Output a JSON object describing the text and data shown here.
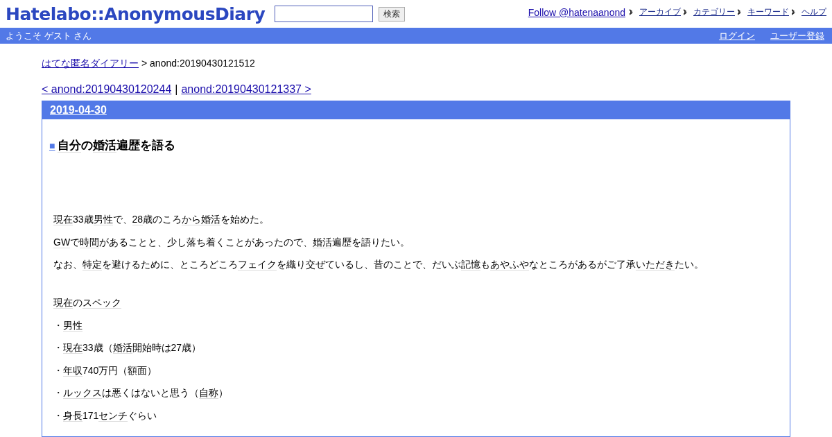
{
  "header": {
    "logo": "Hatelabo::AnonymousDiary",
    "search": {
      "button": "検索"
    },
    "follow": "Follow @hatenaanond",
    "nav": [
      "アーカイブ",
      "カテゴリー",
      "キーワード",
      "ヘルプ"
    ]
  },
  "user_bar": {
    "welcome": "ようこそ ゲスト さん",
    "links": [
      "ログイン",
      "ユーザー登録"
    ]
  },
  "breadcrumb": {
    "link": "はてな匿名ダイアリー",
    "current": "> anond:20190430121512"
  },
  "pager": {
    "prev": "< anond:20190430120244",
    "separator": "|",
    "next": "anond:20190430121337 >"
  },
  "entry": {
    "date": "2019-04-30",
    "marker": "■",
    "title": [
      {
        "text": "自分",
        "kind": "keyword"
      },
      {
        "text": "の",
        "kind": "text"
      },
      {
        "text": "婚活",
        "kind": "keyword"
      },
      {
        "text": "遍歴を語る",
        "kind": "text"
      }
    ],
    "sections": [
      [
        [
          {
            "text": "現在",
            "kind": "keyword"
          },
          {
            "text": "33歳",
            "kind": "text"
          },
          {
            "text": "男性",
            "kind": "keyword"
          },
          {
            "text": "で、",
            "kind": "text"
          },
          {
            "text": "28",
            "kind": "keyword"
          },
          {
            "text": "歳のころ",
            "kind": "text"
          },
          {
            "text": "から",
            "kind": "keyword"
          },
          {
            "text": "婚活",
            "kind": "keyword"
          },
          {
            "text": "を始めた。",
            "kind": "text"
          }
        ],
        [
          {
            "text": "GW",
            "kind": "keyword"
          },
          {
            "text": "で",
            "kind": "text"
          },
          {
            "text": "時間",
            "kind": "keyword"
          },
          {
            "text": "があることと、少し落ち着くことがあったので、",
            "kind": "text"
          },
          {
            "text": "婚活",
            "kind": "keyword"
          },
          {
            "text": "遍歴を語りたい。",
            "kind": "text"
          }
        ],
        [
          {
            "text": "なお、",
            "kind": "text"
          },
          {
            "text": "特定",
            "kind": "keyword"
          },
          {
            "text": "を避けるために、ところどころ",
            "kind": "text"
          },
          {
            "text": "フェイク",
            "kind": "keyword"
          },
          {
            "text": "を織り交ぜているし、昔のことで、だいぶ",
            "kind": "text"
          },
          {
            "text": "記憶",
            "kind": "keyword"
          },
          {
            "text": "も",
            "kind": "text"
          },
          {
            "text": "あやふや",
            "kind": "keyword"
          },
          {
            "text": "なところがあるがご了承",
            "kind": "text"
          },
          {
            "text": "いただき",
            "kind": "keyword"
          },
          {
            "text": "たい。",
            "kind": "text"
          }
        ]
      ],
      [
        [
          {
            "text": "現在",
            "kind": "keyword"
          },
          {
            "text": "の",
            "kind": "text"
          },
          {
            "text": "スペック",
            "kind": "keyword"
          }
        ],
        [
          {
            "text": "・",
            "kind": "text"
          },
          {
            "text": "男性",
            "kind": "keyword"
          }
        ],
        [
          {
            "text": "・",
            "kind": "text"
          },
          {
            "text": "現在",
            "kind": "keyword"
          },
          {
            "text": "33歳（",
            "kind": "text"
          },
          {
            "text": "婚活",
            "kind": "keyword"
          },
          {
            "text": "開始時は27歳）",
            "kind": "text"
          }
        ],
        [
          {
            "text": "・",
            "kind": "text"
          },
          {
            "text": "年収",
            "kind": "keyword"
          },
          {
            "text": "740万円（額面）",
            "kind": "text"
          }
        ],
        [
          {
            "text": "・",
            "kind": "text"
          },
          {
            "text": "ルックス",
            "kind": "keyword"
          },
          {
            "text": "は悪くはないと思う（",
            "kind": "text"
          },
          {
            "text": "自称",
            "kind": "keyword"
          },
          {
            "text": "）",
            "kind": "text"
          }
        ],
        [
          {
            "text": "・",
            "kind": "text"
          },
          {
            "text": "身長",
            "kind": "keyword"
          },
          {
            "text": "171",
            "kind": "text"
          },
          {
            "text": "センチ",
            "kind": "keyword"
          },
          {
            "text": "ぐらい",
            "kind": "text"
          }
        ]
      ]
    ]
  }
}
